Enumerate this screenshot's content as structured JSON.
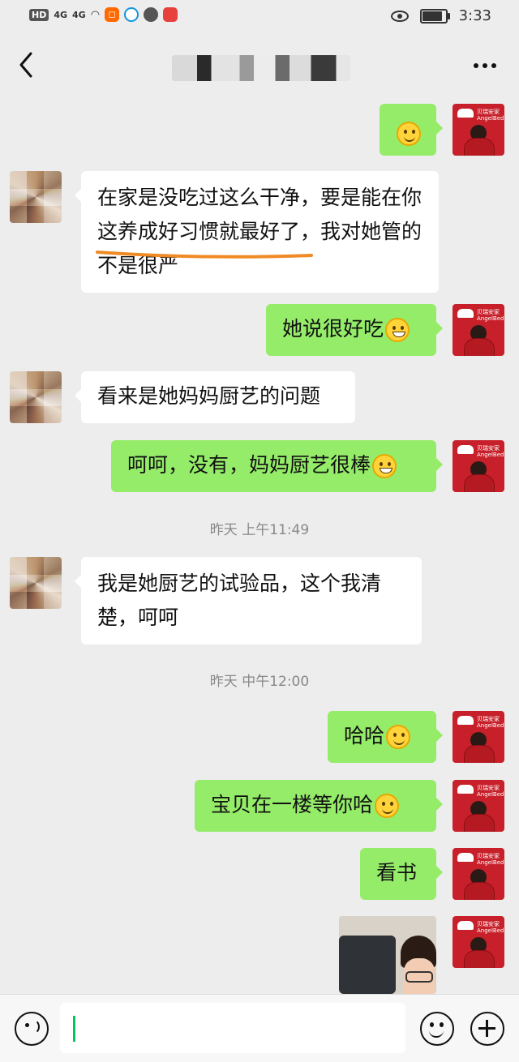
{
  "status_bar": {
    "hd": "HD",
    "sim1": "4G",
    "sim2": "4G",
    "time": "3:33"
  },
  "header": {
    "title": "",
    "back_icon": "chevron-left-icon",
    "more_icon": "more-dots-icon"
  },
  "messages": [
    {
      "from": "me",
      "text": "",
      "emoji": "smiley"
    },
    {
      "from": "other",
      "text": "在家是没吃过这么干净，要是能在你这养成好习惯就最好了，我对她管的不是很严"
    },
    {
      "from": "me",
      "text": "她说很好吃",
      "emoji": "grin"
    },
    {
      "from": "other",
      "text": "看来是她妈妈厨艺的问题"
    },
    {
      "from": "me",
      "text": "呵呵，没有，妈妈厨艺很棒",
      "emoji": "grin"
    },
    {
      "from": "other",
      "text": "我是她厨艺的试验品，这个我清楚，呵呵"
    },
    {
      "from": "me",
      "text": "哈哈",
      "emoji": "smiley"
    },
    {
      "from": "me",
      "text": "宝贝在一楼等你哈",
      "emoji": "smiley"
    },
    {
      "from": "me",
      "text": "看书"
    },
    {
      "from": "me",
      "type": "photo"
    }
  ],
  "timestamps": [
    "昨天 上午11:49",
    "昨天 中午12:00"
  ],
  "input_bar": {
    "voice_icon": "voice-icon",
    "emoji_icon": "emoji-icon",
    "plus_icon": "plus-icon"
  }
}
